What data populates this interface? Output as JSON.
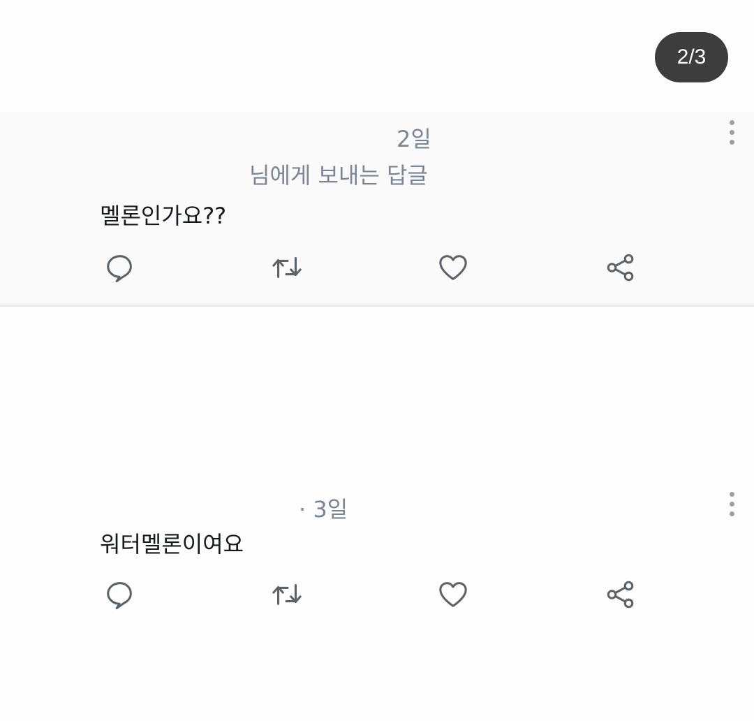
{
  "pager": {
    "label": "2/3"
  },
  "tweets": [
    {
      "timestamp": "2일",
      "reply_to": "님에게 보내는 답글",
      "text": "멜론인가요??",
      "icons": {
        "more": "more-vertical-icon",
        "reply": "reply-icon",
        "retweet": "retweet-icon",
        "like": "heart-icon",
        "share": "share-icon"
      }
    },
    {
      "timestamp": "· 3일",
      "text": "워터멜론이여요",
      "icons": {
        "more": "more-vertical-icon",
        "reply": "reply-icon",
        "retweet": "retweet-icon",
        "like": "heart-icon",
        "share": "share-icon"
      }
    }
  ],
  "colors": {
    "text_primary": "#16191d",
    "text_secondary": "#7a8593",
    "icon": "#5b6268",
    "badge_bg": "#3d3d3d",
    "divider": "#e8e8ea"
  }
}
